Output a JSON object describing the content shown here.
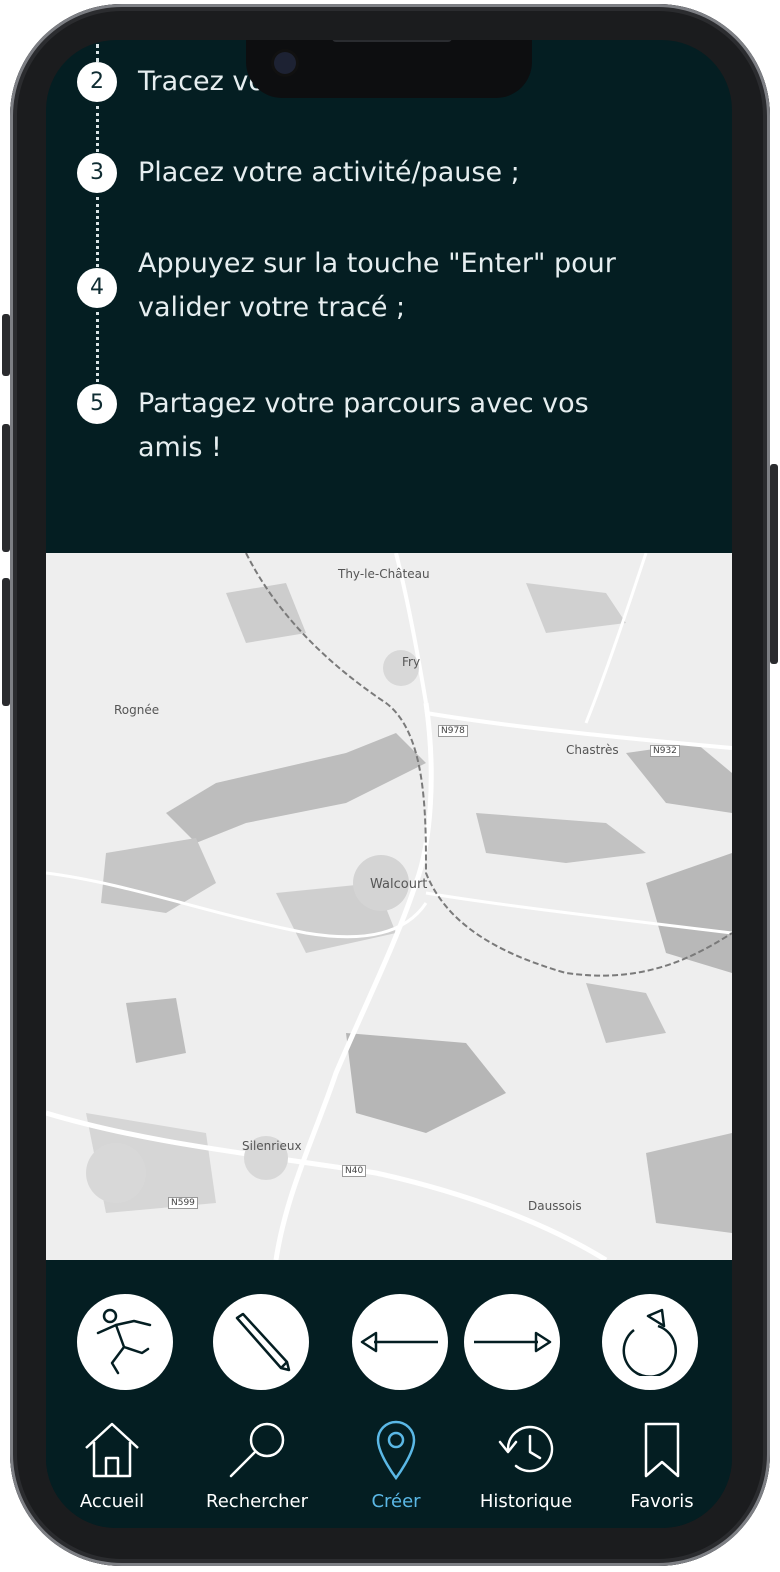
{
  "steps": [
    {
      "num": "2",
      "text": "Tracez vo"
    },
    {
      "num": "3",
      "text": "Placez votre activité/pause ;"
    },
    {
      "num": "4",
      "text": "Appuyez sur la touche \"Enter\" pour valider votre tracé ;"
    },
    {
      "num": "5",
      "text": "Partagez votre parcours avec vos amis !"
    }
  ],
  "map": {
    "places": [
      "Thy-le-Château",
      "Fry",
      "Rognée",
      "Chastrès",
      "Walcourt",
      "Silenrieux",
      "Daussois"
    ],
    "roads": [
      "N978",
      "N932",
      "N40",
      "N599"
    ]
  },
  "tools": [
    {
      "icon": "activity-person-icon"
    },
    {
      "icon": "pencil-icon"
    },
    {
      "icon": "arrow-left-icon"
    },
    {
      "icon": "arrow-right-icon"
    },
    {
      "icon": "reset-icon"
    }
  ],
  "nav": {
    "items": [
      {
        "label": "Accueil",
        "icon": "home-icon"
      },
      {
        "label": "Rechercher",
        "icon": "search-icon"
      },
      {
        "label": "Créer",
        "icon": "location-pin-icon",
        "active": true
      },
      {
        "label": "Historique",
        "icon": "history-icon"
      },
      {
        "label": "Favoris",
        "icon": "bookmark-icon"
      }
    ]
  },
  "colors": {
    "background": "#041e22",
    "accent": "#5bb8e6",
    "text": "#e6eef0"
  }
}
